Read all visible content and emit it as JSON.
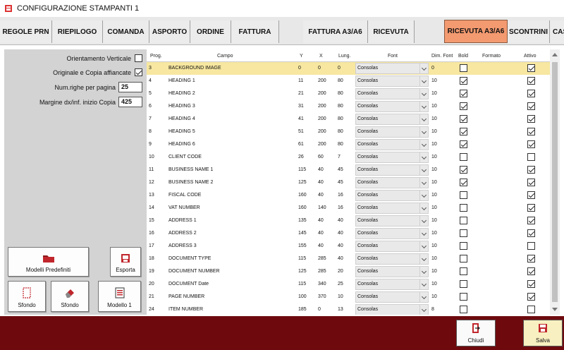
{
  "window": {
    "title": "CONFIGURAZIONE STAMPANTI 1"
  },
  "tabs": [
    {
      "label": "REGOLE PRN",
      "active": false
    },
    {
      "label": "RIEPILOGO",
      "active": false
    },
    {
      "label": "COMANDA",
      "active": false
    },
    {
      "label": "ASPORTO",
      "active": false
    },
    {
      "label": "ORDINE",
      "active": false
    },
    {
      "label": "FATTURA",
      "active": false
    },
    {
      "label": "FATTURA A3/A6",
      "active": false
    },
    {
      "label": "RICEVUTA",
      "active": false
    },
    {
      "label": "RICEVUTA A3/A6",
      "active": true
    },
    {
      "label": "SCONTRINI",
      "active": false
    },
    {
      "label": "CAS",
      "active": false
    }
  ],
  "options": {
    "orientamento_label": "Orientamento Verticale",
    "orientamento_checked": false,
    "affiancate_label": "Originale e Copia affiancate",
    "affiancate_checked": true,
    "num_righe_label": "Num.righe per pagina",
    "num_righe_value": "25",
    "margine_label": "Margine dx/inf. inizio Copia",
    "margine_value": "425"
  },
  "buttons": {
    "modelli": "Modelli Predefiniti",
    "esporta": "Esporta",
    "sfondo1": "Sfondo",
    "sfondo2": "Sfondo",
    "modello1": "Modello 1",
    "chiudi": "Chiudi",
    "salva": "Salva"
  },
  "grid": {
    "headers": {
      "prog": "Prog.",
      "campo": "Campo",
      "y": "Y",
      "x": "X",
      "lung": "Lung.",
      "font": "Font",
      "dim": "Dim. Font",
      "bold": "Bold",
      "formato": "Formato",
      "attivo": "Attivo"
    },
    "rows": [
      {
        "prog": "3",
        "campo": "BACKGROUND IMAGE",
        "y": "0",
        "x": "0",
        "lung": "0",
        "font": "Consolas",
        "dim": "0",
        "bold": false,
        "attivo": true,
        "selected": true
      },
      {
        "prog": "4",
        "campo": "HEADING 1",
        "y": "11",
        "x": "200",
        "lung": "80",
        "font": "Consolas",
        "dim": "10",
        "bold": true,
        "attivo": true
      },
      {
        "prog": "5",
        "campo": "HEADING 2",
        "y": "21",
        "x": "200",
        "lung": "80",
        "font": "Consolas",
        "dim": "10",
        "bold": true,
        "attivo": true
      },
      {
        "prog": "6",
        "campo": "HEADING 3",
        "y": "31",
        "x": "200",
        "lung": "80",
        "font": "Consolas",
        "dim": "10",
        "bold": true,
        "attivo": true
      },
      {
        "prog": "7",
        "campo": "HEADING 4",
        "y": "41",
        "x": "200",
        "lung": "80",
        "font": "Consolas",
        "dim": "10",
        "bold": true,
        "attivo": true
      },
      {
        "prog": "8",
        "campo": "HEADING 5",
        "y": "51",
        "x": "200",
        "lung": "80",
        "font": "Consolas",
        "dim": "10",
        "bold": true,
        "attivo": true
      },
      {
        "prog": "9",
        "campo": "HEADING 6",
        "y": "61",
        "x": "200",
        "lung": "80",
        "font": "Consolas",
        "dim": "10",
        "bold": true,
        "attivo": true
      },
      {
        "prog": "10",
        "campo": "CLIENT CODE",
        "y": "26",
        "x": "60",
        "lung": "7",
        "font": "Consolas",
        "dim": "10",
        "bold": false,
        "attivo": false
      },
      {
        "prog": "11",
        "campo": "BUSINESS NAME 1",
        "y": "115",
        "x": "40",
        "lung": "45",
        "font": "Consolas",
        "dim": "10",
        "bold": true,
        "attivo": true
      },
      {
        "prog": "12",
        "campo": "BUSINESS NAME 2",
        "y": "125",
        "x": "40",
        "lung": "45",
        "font": "Consolas",
        "dim": "10",
        "bold": true,
        "attivo": true
      },
      {
        "prog": "13",
        "campo": "FISCAL CODE",
        "y": "160",
        "x": "40",
        "lung": "16",
        "font": "Consolas",
        "dim": "10",
        "bold": false,
        "attivo": true
      },
      {
        "prog": "14",
        "campo": "VAT NUMBER",
        "y": "160",
        "x": "140",
        "lung": "16",
        "font": "Consolas",
        "dim": "10",
        "bold": false,
        "attivo": true
      },
      {
        "prog": "15",
        "campo": "ADDRESS 1",
        "y": "135",
        "x": "40",
        "lung": "40",
        "font": "Consolas",
        "dim": "10",
        "bold": false,
        "attivo": true
      },
      {
        "prog": "16",
        "campo": "ADDRESS 2",
        "y": "145",
        "x": "40",
        "lung": "40",
        "font": "Consolas",
        "dim": "10",
        "bold": false,
        "attivo": true
      },
      {
        "prog": "17",
        "campo": "ADDRESS 3",
        "y": "155",
        "x": "40",
        "lung": "40",
        "font": "Consolas",
        "dim": "10",
        "bold": false,
        "attivo": false
      },
      {
        "prog": "18",
        "campo": "DOCUMENT TYPE",
        "y": "115",
        "x": "285",
        "lung": "40",
        "font": "Consolas",
        "dim": "10",
        "bold": false,
        "attivo": true
      },
      {
        "prog": "19",
        "campo": "DOCUMENT NUMBER",
        "y": "125",
        "x": "285",
        "lung": "20",
        "font": "Consolas",
        "dim": "10",
        "bold": false,
        "attivo": true
      },
      {
        "prog": "20",
        "campo": "DOCUMENT Date",
        "y": "115",
        "x": "340",
        "lung": "25",
        "font": "Consolas",
        "dim": "10",
        "bold": false,
        "attivo": true
      },
      {
        "prog": "21",
        "campo": "PAGE NUMBER",
        "y": "100",
        "x": "370",
        "lung": "10",
        "font": "Consolas",
        "dim": "10",
        "bold": false,
        "attivo": true
      },
      {
        "prog": "24",
        "campo": "ITEM NUMBER",
        "y": "185",
        "x": "0",
        "lung": "13",
        "font": "Consolas",
        "dim": "8",
        "bold": false,
        "attivo": false
      }
    ]
  }
}
